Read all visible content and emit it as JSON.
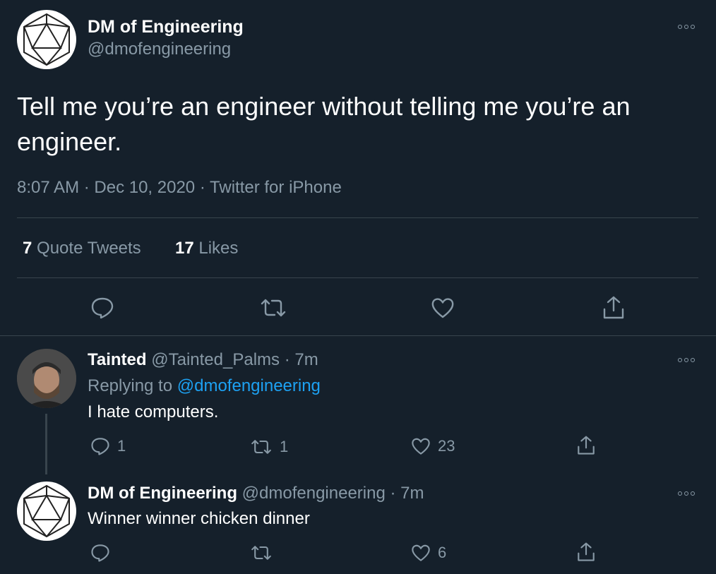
{
  "tweet": {
    "author_name": "DM of Engineering",
    "author_handle": "@dmofengineering",
    "text": "Tell me you’re an engineer without telling me you’re an engineer.",
    "meta": "8:07 AM · Dec 10, 2020 · Twitter for iPhone",
    "quote_count": "7",
    "quote_label": "Quote Tweets",
    "like_count": "17",
    "like_label": "Likes"
  },
  "replies": [
    {
      "name": "Tainted",
      "handle": "@Tainted_Palms",
      "time": "· 7m",
      "replying_prefix": "Replying to",
      "replying_to": "@dmofengineering",
      "text": "I hate computers.",
      "reply_count": "1",
      "retweet_count": "1",
      "like_count": "23"
    },
    {
      "name": "DM of Engineering",
      "handle": "@dmofengineering",
      "time": "· 7m",
      "text": "Winner winner chicken dinner",
      "like_count": "6"
    }
  ],
  "icons": {
    "reply": "reply-icon",
    "retweet": "retweet-icon",
    "like": "heart-icon",
    "share": "share-icon",
    "more": "more-icon",
    "avatar_d20": "d20-dice-avatar",
    "avatar_person": "person-avatar"
  },
  "colors": {
    "background": "#15202b",
    "muted": "#8899a6",
    "link": "#1da1f2",
    "divider": "#38444d"
  }
}
